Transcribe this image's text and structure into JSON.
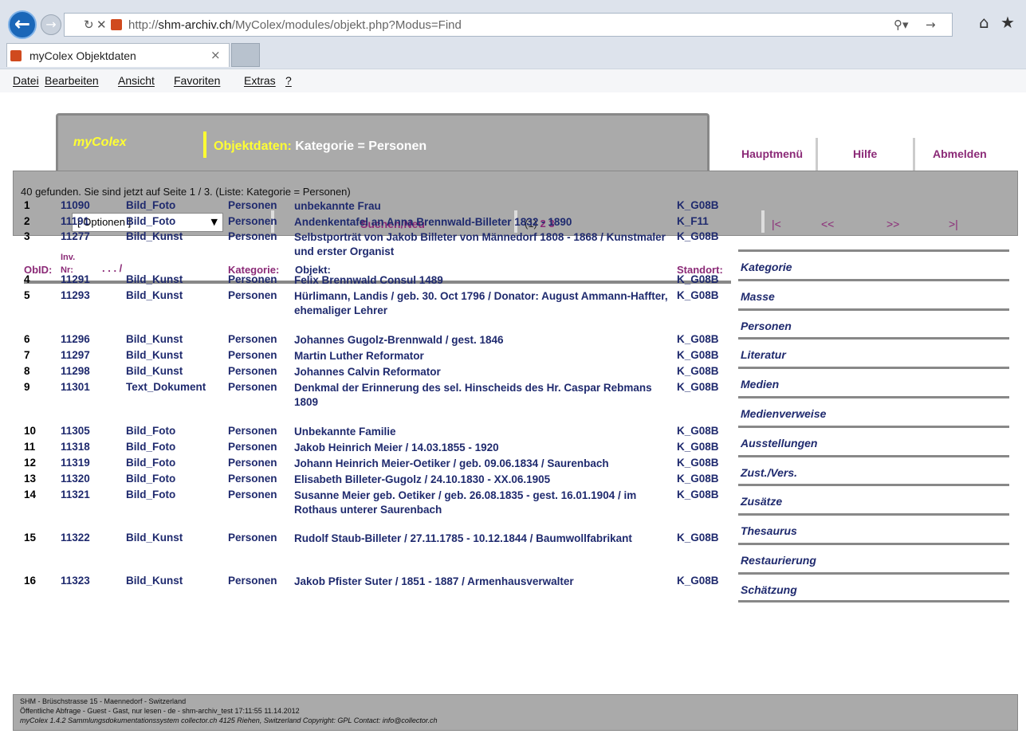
{
  "browser": {
    "url_prefix": "http://",
    "url_domain": "shm-archiv.ch",
    "url_path": "/MyColex/modules/objekt.php?Modus=Find",
    "tab_title": "myColex Objektdaten",
    "menu": [
      "Datei",
      "Bearbeiten",
      "Ansicht",
      "Favoriten",
      "Extras",
      "?"
    ]
  },
  "header": {
    "brand": "myColex",
    "title_prefix": "Objektdaten: ",
    "title_rest": "Kategorie = Personen",
    "nav": [
      "Hauptmenü",
      "Hilfe",
      "Abmelden"
    ]
  },
  "toolbar": {
    "hitcount": "40 gefunden. Sie sind jetzt auf Seite 1 / 3.  (Liste: Kategorie = Personen)",
    "options": "[ Optionen ]",
    "search_new": "Suchen/Neu",
    "page_current": "(1)",
    "page_links": "2 3",
    "nav": [
      "|<",
      "<<",
      ">>",
      ">|"
    ]
  },
  "table": {
    "headers": {
      "id": "ObID:",
      "inv1": "Inv.",
      "inv2": "Nr:",
      "dots": ". . . /",
      "kat": "Kategorie:",
      "obj": "Objekt:",
      "st": "Standort:"
    },
    "rows": [
      {
        "id": "1",
        "inv": "11090",
        "type": "Bild_Foto",
        "kat": "Personen",
        "obj": "unbekannte Frau",
        "st": "K_G08B"
      },
      {
        "id": "2",
        "inv": "11191",
        "type": "Bild_Foto",
        "kat": "Personen",
        "obj": "Andenkentafel an Anna Brennwald-Billeter 1832 - 1890",
        "st": "K_F11"
      },
      {
        "id": "3",
        "inv": "11277",
        "type": "Bild_Kunst",
        "kat": "Personen",
        "obj": "Selbstporträt von Jakob Billeter von Männedorf 1808 - 1868 / Kunstmaler und erster Organist",
        "st": "K_G08B"
      },
      {
        "id": "4",
        "inv": "11291",
        "type": "Bild_Kunst",
        "kat": "Personen",
        "obj": "Felix Brennwald Consul 1489",
        "st": "K_G08B"
      },
      {
        "id": "5",
        "inv": "11293",
        "type": "Bild_Kunst",
        "kat": "Personen",
        "obj": "Hürlimann, Landis / geb. 30. Oct 1796 / Donator: August Ammann-Haffter, ehemaliger Lehrer",
        "st": "K_G08B"
      },
      {
        "id": "6",
        "inv": "11296",
        "type": "Bild_Kunst",
        "kat": "Personen",
        "obj": "Johannes Gugolz-Brennwald / gest. 1846",
        "st": "K_G08B"
      },
      {
        "id": "7",
        "inv": "11297",
        "type": "Bild_Kunst",
        "kat": "Personen",
        "obj": "Martin Luther Reformator",
        "st": "K_G08B"
      },
      {
        "id": "8",
        "inv": "11298",
        "type": "Bild_Kunst",
        "kat": "Personen",
        "obj": "Johannes Calvin Reformator",
        "st": "K_G08B"
      },
      {
        "id": "9",
        "inv": "11301",
        "type": "Text_Dokument",
        "kat": "Personen",
        "obj": "Denkmal der Erinnerung des sel. Hinscheids des Hr. Caspar Rebmans 1809",
        "st": "K_G08B"
      },
      {
        "id": "10",
        "inv": "11305",
        "type": "Bild_Foto",
        "kat": "Personen",
        "obj": "Unbekannte Familie",
        "st": "K_G08B"
      },
      {
        "id": "11",
        "inv": "11318",
        "type": "Bild_Foto",
        "kat": "Personen",
        "obj": "Jakob Heinrich Meier / 14.03.1855 - 1920",
        "st": "K_G08B"
      },
      {
        "id": "12",
        "inv": "11319",
        "type": "Bild_Foto",
        "kat": "Personen",
        "obj": "Johann Heinrich Meier-Oetiker / geb. 09.06.1834 / Saurenbach",
        "st": "K_G08B"
      },
      {
        "id": "13",
        "inv": "11320",
        "type": "Bild_Foto",
        "kat": "Personen",
        "obj": "Elisabeth Billeter-Gugolz / 24.10.1830 - XX.06.1905",
        "st": "K_G08B"
      },
      {
        "id": "14",
        "inv": "11321",
        "type": "Bild_Foto",
        "kat": "Personen",
        "obj": "Susanne Meier geb. Oetiker / geb. 26.08.1835 - gest. 16.01.1904 / im Rothaus unterer Saurenbach",
        "st": "K_G08B"
      },
      {
        "id": "15",
        "inv": "11322",
        "type": "Bild_Kunst",
        "kat": "Personen",
        "obj": "Rudolf Staub-Billeter / 27.11.1785 - 10.12.1844 / Baumwollfabrikant",
        "st": "K_G08B"
      },
      {
        "id": "16",
        "inv": "11323",
        "type": "Bild_Kunst",
        "kat": "Personen",
        "obj": "Jakob Pfister Suter / 1851 - 1887 / Armenhausverwalter",
        "st": "K_G08B"
      }
    ]
  },
  "side": [
    "Kategorie",
    "Masse",
    "Personen",
    "Literatur",
    "Medien",
    "Medienverweise",
    "Ausstellungen",
    "Zust./Vers.",
    "Zusätze",
    "Thesaurus",
    "Restaurierung",
    "Schätzung"
  ],
  "footer": {
    "line1": "SHM - Brüschstrasse 15 - Maennedorf - Switzerland",
    "line2": "Öffentliche Abfrage - Guest - Gast, nur lesen - de - shm-archiv_test 17:11:55 11.14.2012",
    "line3": "myColex 1.4.2 Sammlungsdokumentationssystem collector.ch 4125 Riehen, Switzerland Copyright: GPL Contact: info@collector.ch"
  }
}
